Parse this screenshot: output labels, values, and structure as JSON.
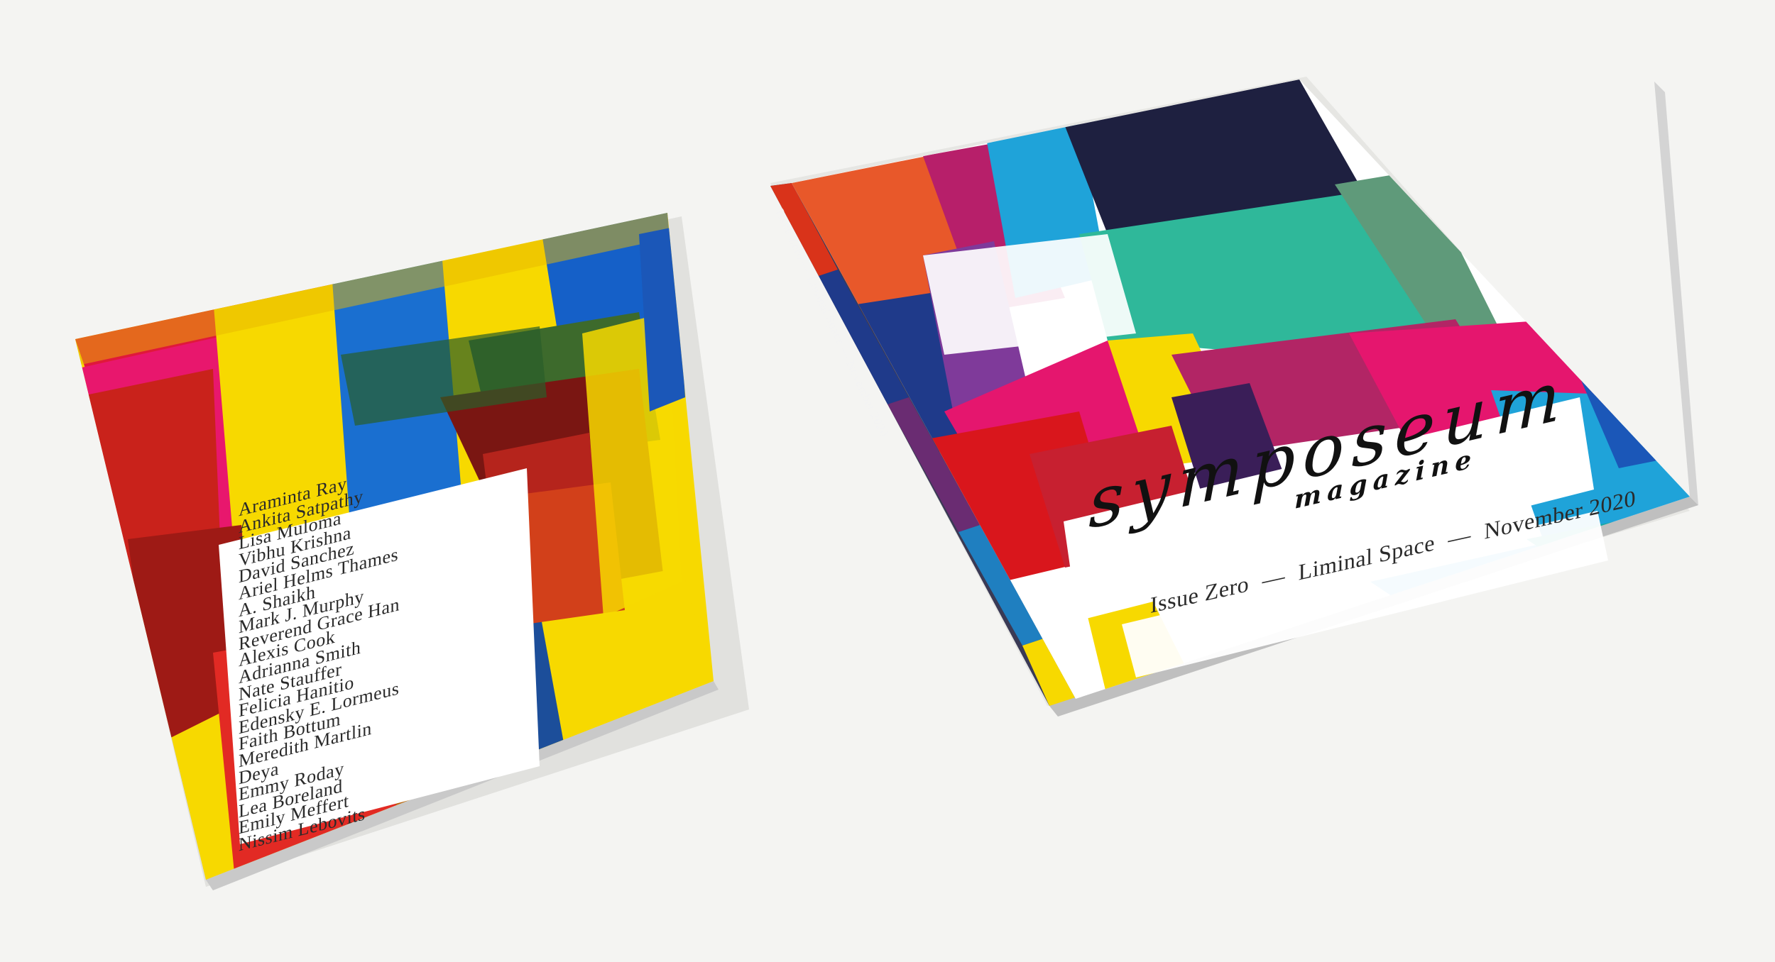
{
  "back_cover": {
    "contributors": [
      "Araminta Ray",
      "Ankita Satpathy",
      "Lisa Muloma",
      "Vibhu Krishna",
      "David Sanchez",
      "Ariel Helms Thames",
      "A. Shaikh",
      "Mark J. Murphy",
      "Reverend Grace Han",
      "Alexis Cook",
      "Adrianna Smith",
      "Nate Stauffer",
      "Felicia Hanitio",
      "Edensky E. Lormeus",
      "Faith Bottum",
      "Meredith Martlin",
      "Deya",
      "Emmy Roday",
      "Lea Boreland",
      "Emily Meffert",
      "Nissim Lebovits"
    ]
  },
  "front_cover": {
    "title": "symposeum",
    "subtitle": "magazine",
    "issue": "Issue Zero",
    "separator": "—",
    "theme": "Liminal Space",
    "date": "November 2020"
  },
  "spine": {
    "text": "Issue Zero — Liminal Space — November 2020"
  },
  "colors": {
    "background": "#f4f4f2",
    "yellow": "#f7d900",
    "red": "#d9161c",
    "magenta": "#e5166e",
    "blue": "#1a6fd0",
    "cyan": "#1fa3d9",
    "teal": "#2fb89a",
    "navy": "#1e2040"
  }
}
